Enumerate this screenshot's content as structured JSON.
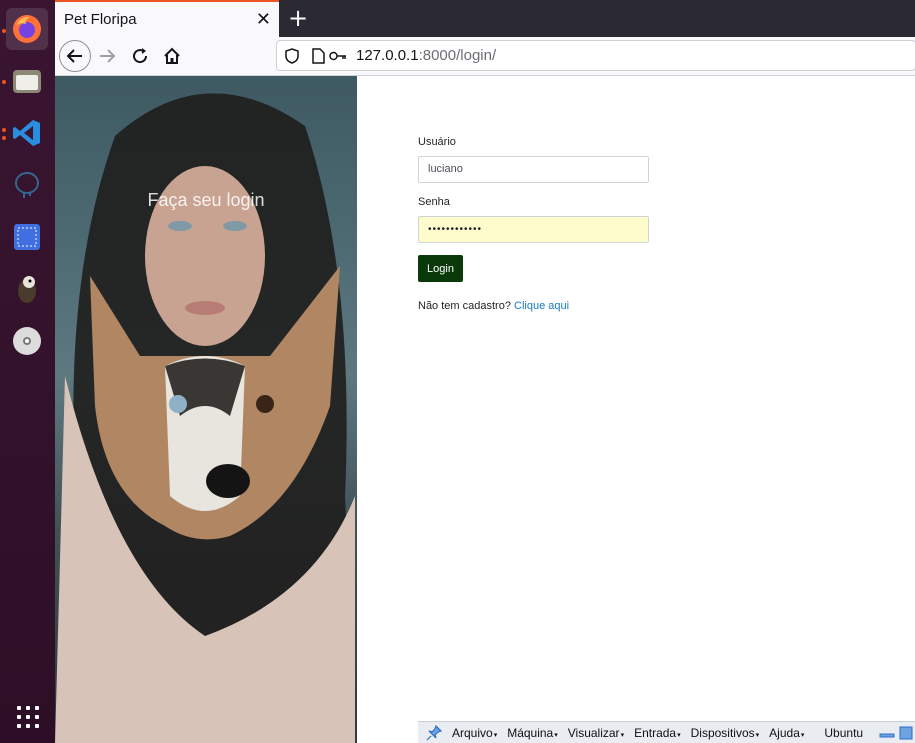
{
  "browser": {
    "tab_title": "Pet Floripa",
    "url_host": "127.0.0.1",
    "url_rest": ":8000/login/"
  },
  "hero": {
    "caption": "Faça seu login"
  },
  "form": {
    "username_label": "Usuário",
    "username_value": "luciano",
    "password_label": "Senha",
    "password_value": "••••••••••••",
    "login_button": "Login",
    "signup_prompt": "Não tem cadastro?",
    "signup_link": "Clique aqui"
  },
  "vbox_menu": {
    "items": [
      "Arquivo",
      "Máquina",
      "Visualizar",
      "Entrada",
      "Dispositivos",
      "Ajuda"
    ],
    "vm_name": "Ubuntu"
  },
  "colors": {
    "login_button_bg": "#0a3a0a",
    "link": "#1a7bbf",
    "autofill_bg": "#fefbcd"
  },
  "dock": {
    "icons": [
      "firefox-icon",
      "files-icon",
      "vscode-icon",
      "postgresql-icon",
      "screenshot-icon",
      "pgadmin-icon",
      "disc-icon",
      "apps-grid-icon"
    ]
  }
}
